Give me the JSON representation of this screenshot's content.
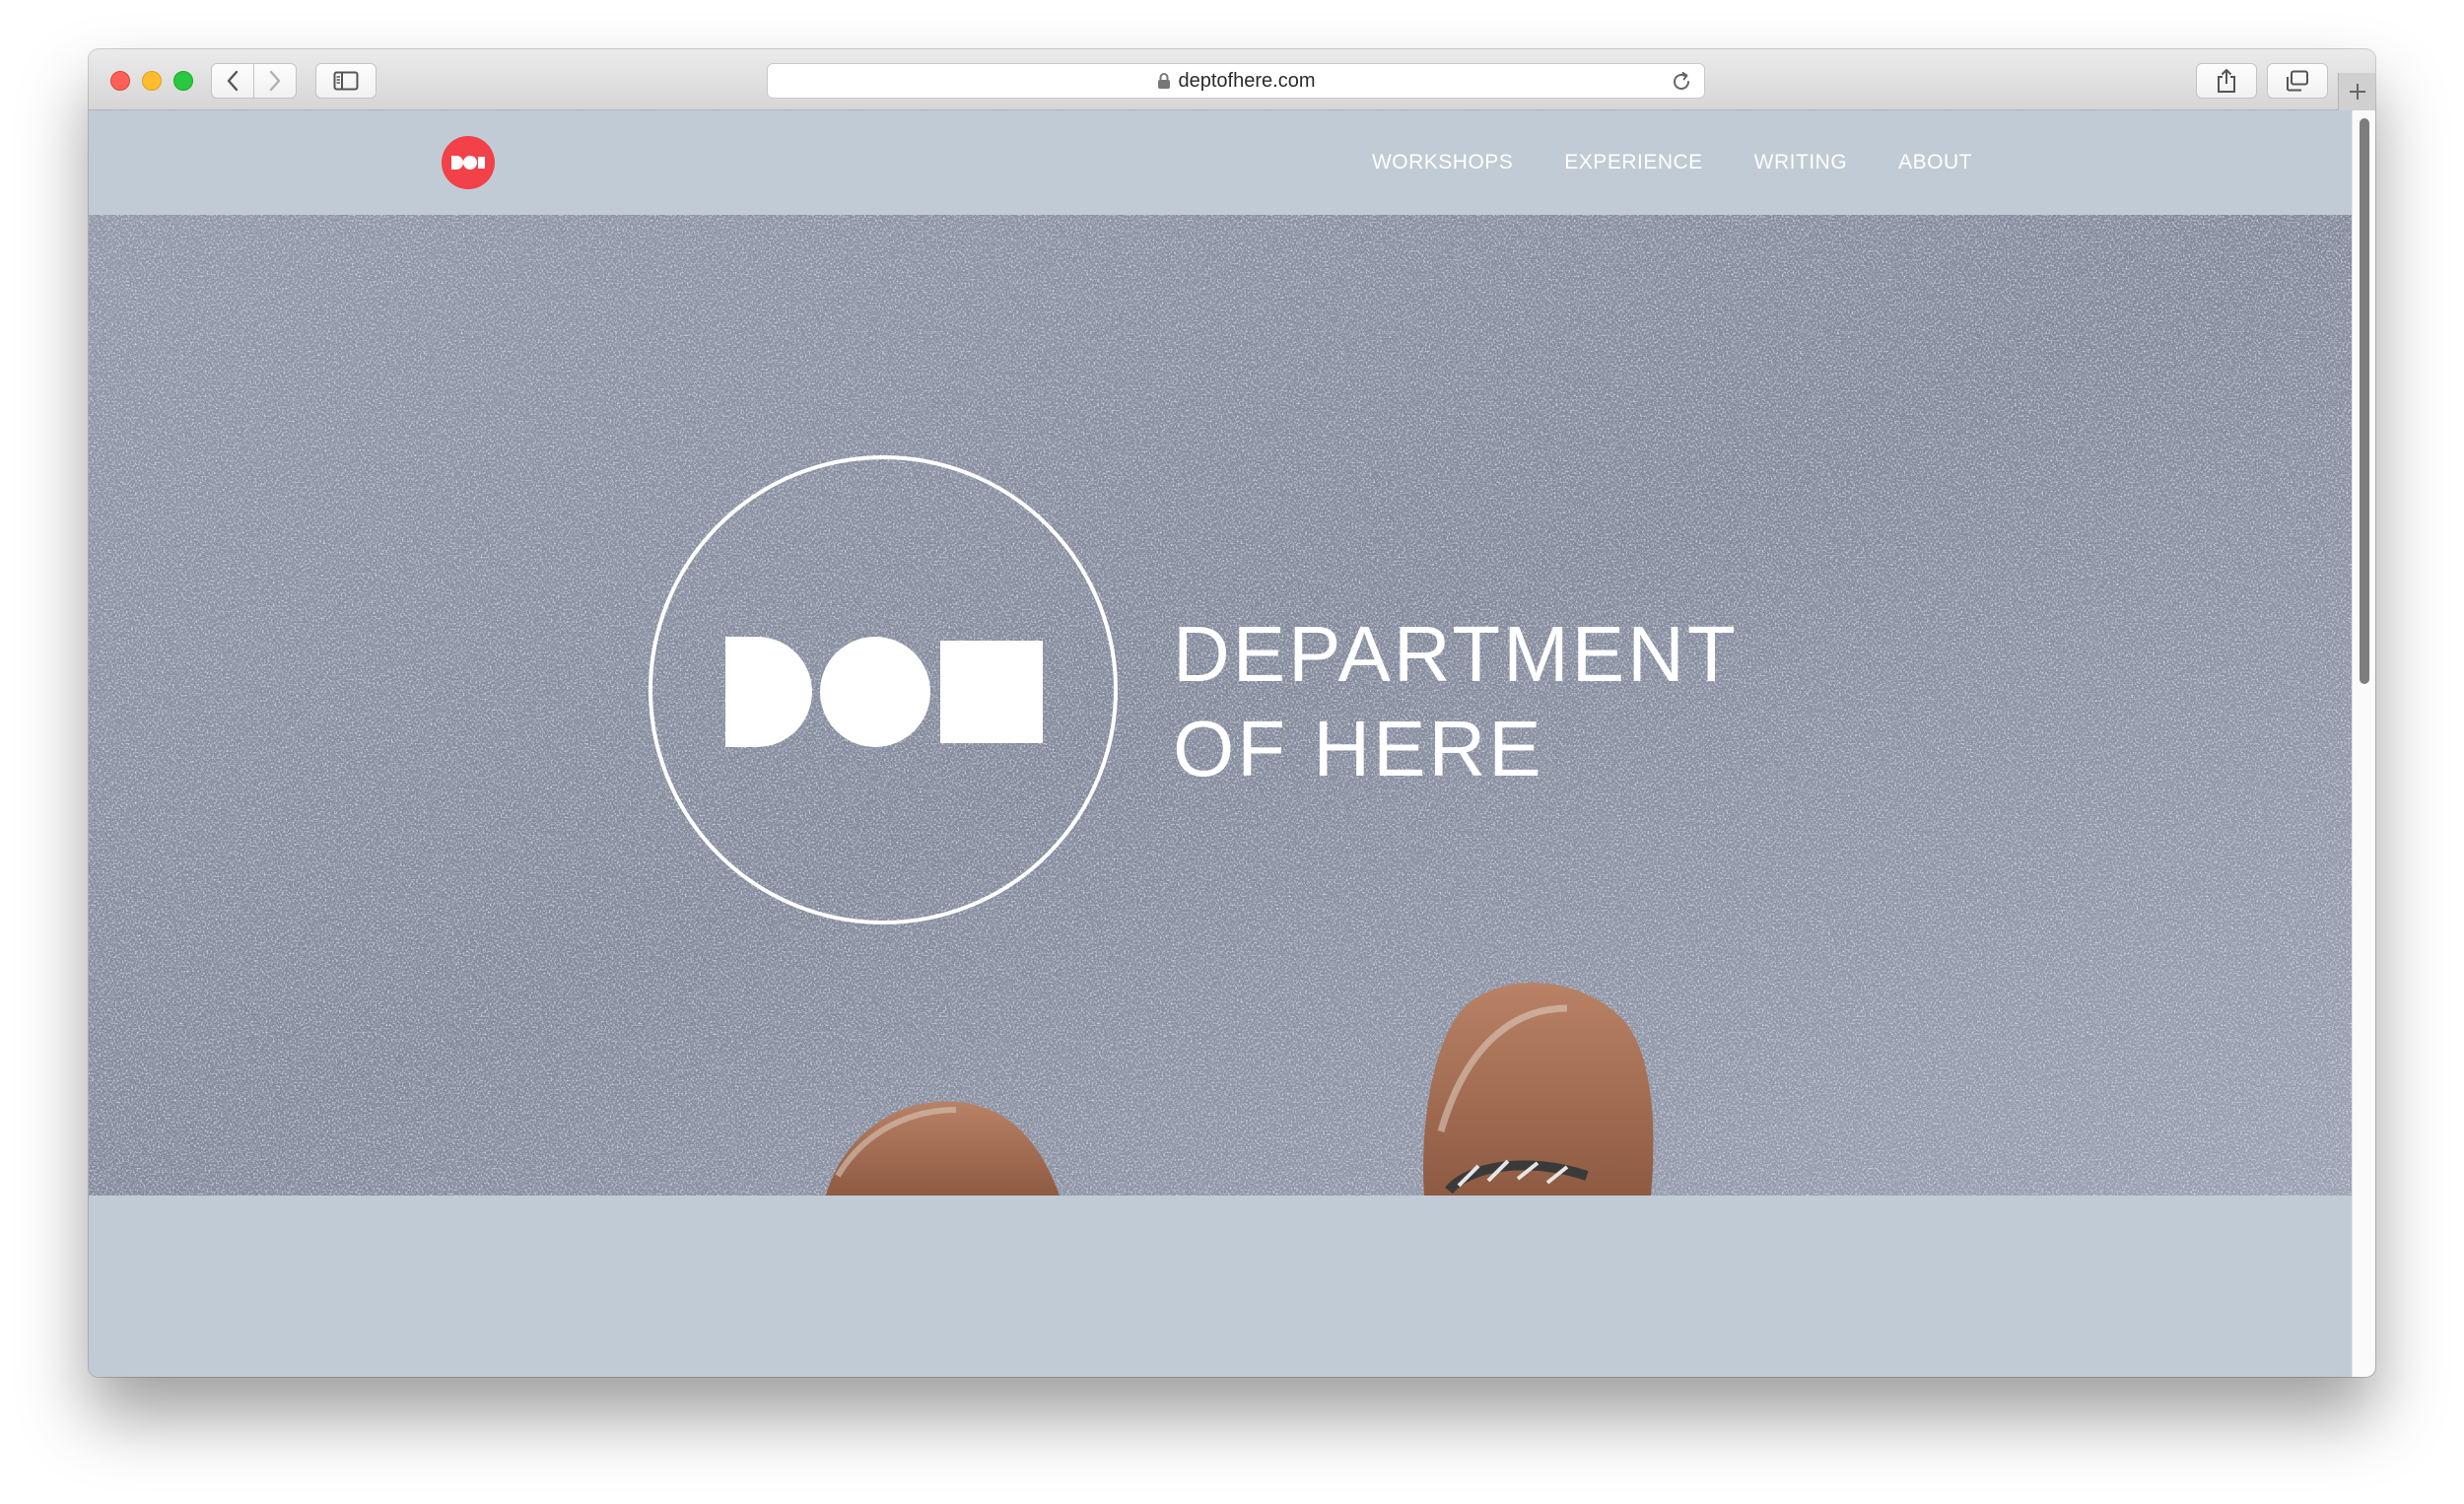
{
  "browser": {
    "url": "deptofhere.com",
    "icons": {
      "back": "chevron-left-icon",
      "forward": "chevron-right-icon",
      "sidebar": "sidebar-icon",
      "lock": "lock-icon",
      "reload": "reload-icon",
      "share": "share-icon",
      "tabs": "tabs-overview-icon",
      "new_tab": "plus-icon"
    }
  },
  "site": {
    "nav": [
      "WORKSHOPS",
      "EXPERIENCE",
      "WRITING",
      "ABOUT"
    ],
    "hero": {
      "title_line1": "DEPARTMENT",
      "title_line2": "OF HERE"
    },
    "colors": {
      "logo_red": "#f24148",
      "header_bg": "#c1cbd6",
      "text": "#ffffff"
    }
  }
}
